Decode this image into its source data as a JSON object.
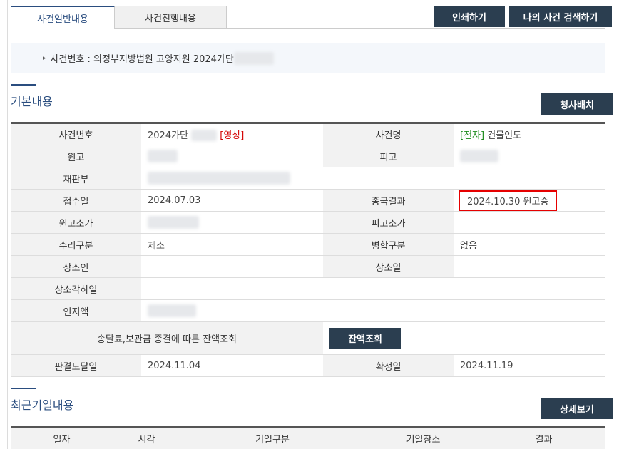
{
  "tabs": [
    {
      "label": "사건일반내용",
      "active": true
    },
    {
      "label": "사건진행내용",
      "active": false
    }
  ],
  "buttons": {
    "print": "인쇄하기",
    "my_case_search": "나의 사건 검색하기",
    "party_arrangement": "청사배치",
    "balance_lookup": "잔액조회",
    "details": "상세보기"
  },
  "crumb": {
    "prefix": "사건번호 : 의정부지방법원 고양지원 2024가단"
  },
  "basic": {
    "title": "기본내용",
    "rows": {
      "case_no_label": "사건번호",
      "case_no_value": "2024가단",
      "case_no_tag": "[영상]",
      "case_name_label": "사건명",
      "case_name_tag": "[전자]",
      "case_name_value": "건물인도",
      "plaintiff_label": "원고",
      "defendant_label": "피고",
      "court_label": "재판부",
      "filed_label": "접수일",
      "filed_value": "2024.07.03",
      "result_label": "종국결과",
      "result_value": "2024.10.30 원고승",
      "plaintiff_value_label": "원고소가",
      "defendant_value_label": "피고소가",
      "acceptance_label": "수리구분",
      "acceptance_value": "제소",
      "merge_label": "병합구분",
      "merge_value": "없음",
      "appellant_label": "상소인",
      "appeal_date_label": "상소일",
      "appeal_dismiss_label": "상소각하일",
      "stamp_label": "인지액",
      "balance_text": "송달료,보관금 종결에 따른 잔액조회",
      "judgment_delivery_label": "판결도달일",
      "judgment_delivery_value": "2024.11.04",
      "finalized_label": "확정일",
      "finalized_value": "2024.11.19"
    }
  },
  "recent": {
    "title": "최근기일내용",
    "headers": [
      "일자",
      "시각",
      "기일구분",
      "기일장소",
      "결과"
    ]
  },
  "colors": {
    "accent": "#2a4d7f",
    "button": "#2b3e50",
    "highlight": "#e60000"
  }
}
